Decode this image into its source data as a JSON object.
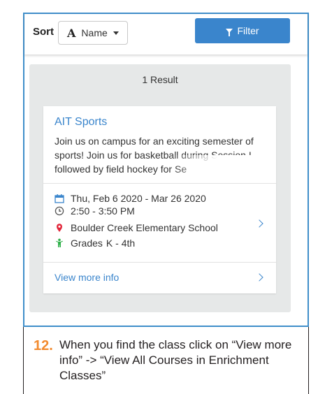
{
  "sort": {
    "label": "Sort",
    "selected": "Name",
    "icon": "alpha-a-icon"
  },
  "filter": {
    "label": "Filter",
    "icon": "funnel-icon",
    "color": "#3a85cc"
  },
  "results": {
    "count_text": "1 Result"
  },
  "card": {
    "title": "AIT Sports",
    "description": "Join us on campus for an exciting semester of sports! Join us for basketball during Session I, followed by field hockey for Se",
    "dates": "Thu, Feb 6 2020 - Mar 26 2020",
    "time": "2:50 - 3:50 PM",
    "location": "Boulder Creek Elementary School",
    "grades_prefix": "Grades",
    "grades_value": "K - 4th",
    "view_more": "View more info",
    "accent_color": "#3a85cc"
  },
  "instruction": {
    "step": "12.",
    "text": "When you find the class click on “View more info” -> “View All Courses in Enrichment Classes”",
    "step_color": "#f28a2e"
  }
}
